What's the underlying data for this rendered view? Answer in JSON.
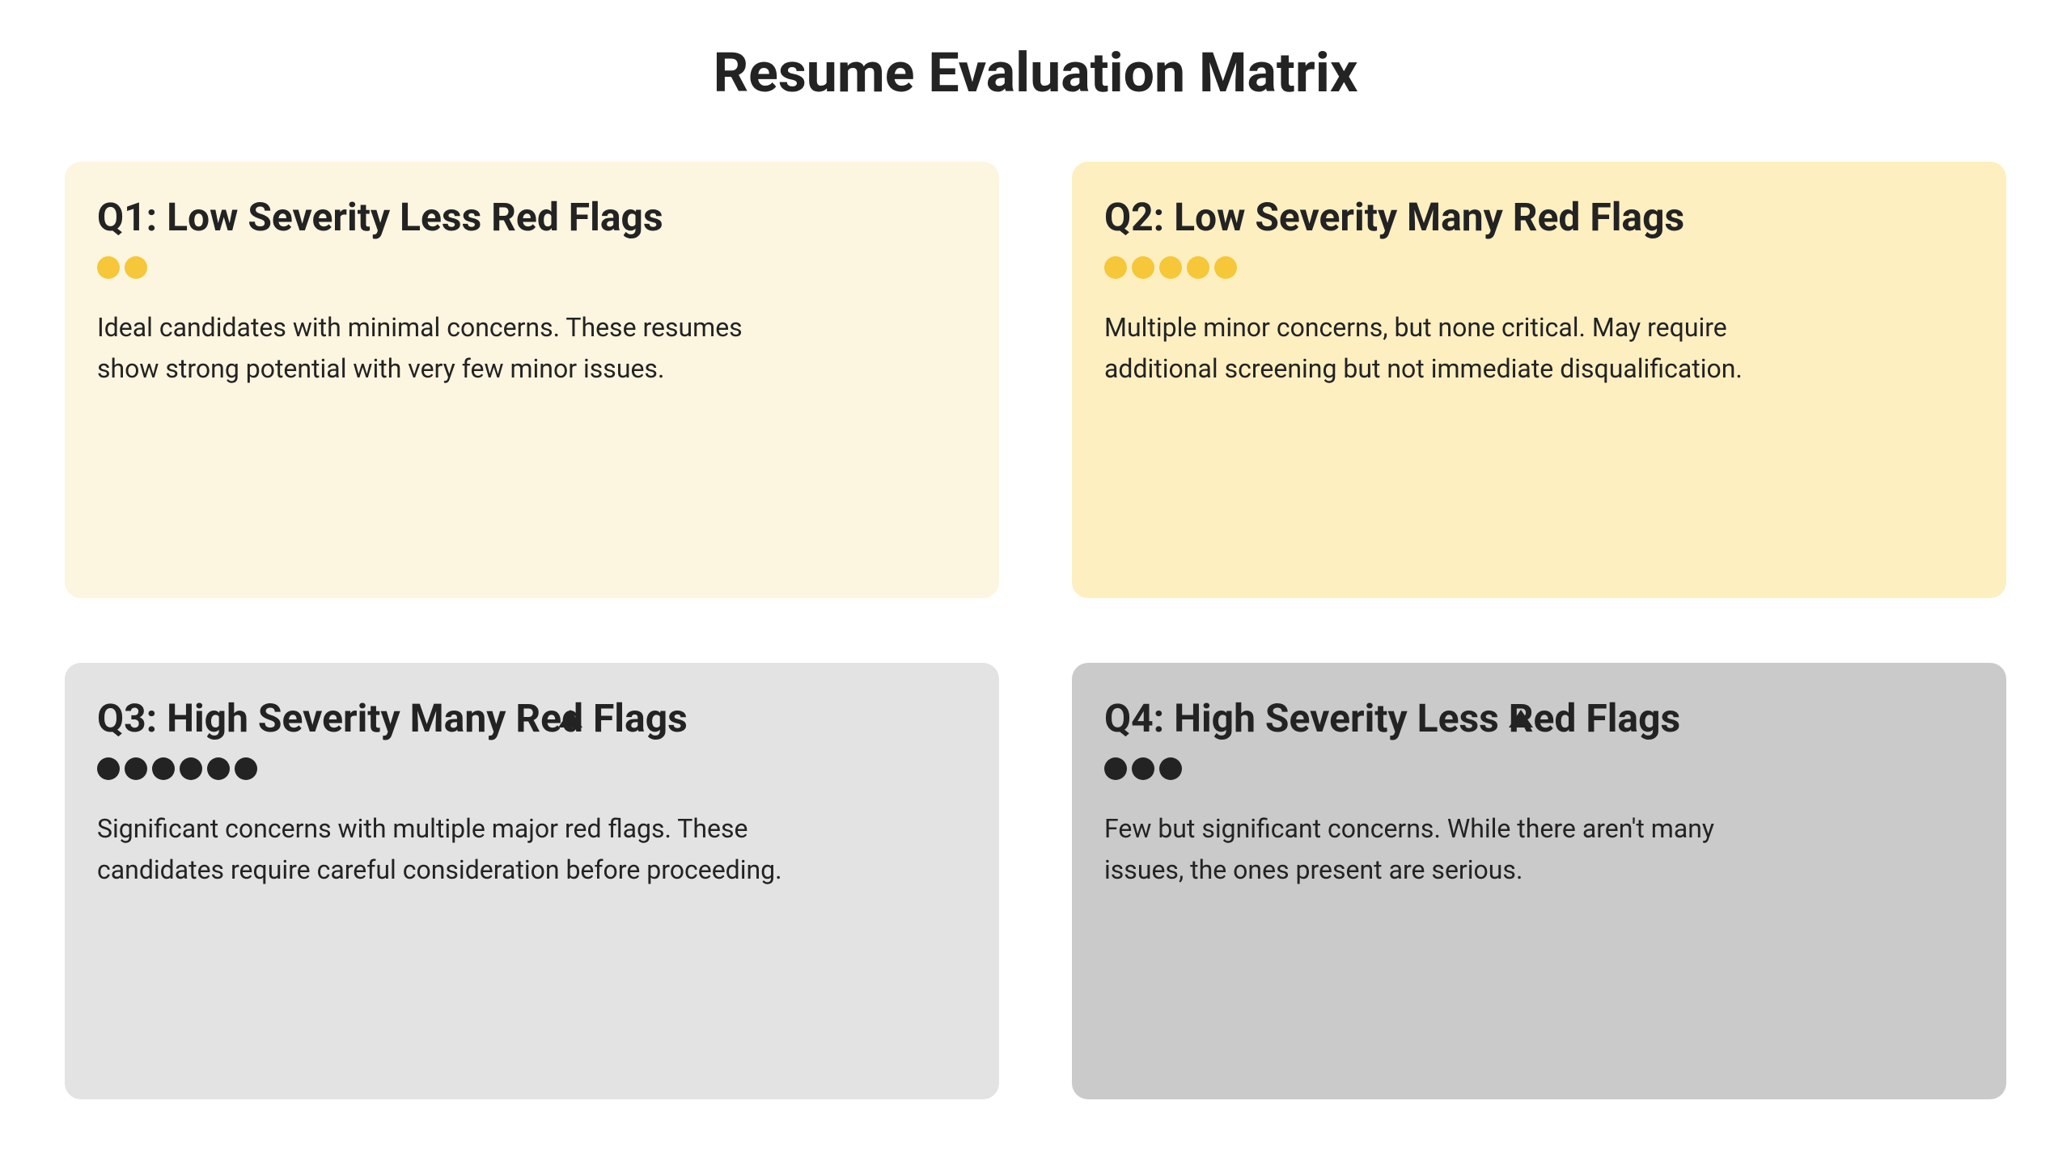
{
  "title": "Resume Evaluation Matrix",
  "quadrants": {
    "q1": {
      "heading": "Q1: Low Severity Less Red Flags",
      "dots": 2,
      "dotColor": "yellow",
      "body": "Ideal candidates with minimal concerns. These resumes show strong potential with very few minor issues."
    },
    "q2": {
      "heading": "Q2: Low Severity Many Red Flags",
      "dots": 5,
      "dotColor": "yellow",
      "body": "Multiple minor concerns, but none critical. May require additional screening but not immediate disqualification."
    },
    "q3": {
      "heading": "Q3: High Severity Many Red Flags",
      "dots": 6,
      "dotColor": "dark",
      "body": "Significant concerns with multiple major red flags. These candidates require careful consideration before proceeding."
    },
    "q4": {
      "heading": "Q4: High Severity Less Red Flags",
      "dots": 3,
      "dotColor": "dark",
      "body": "Few but significant concerns. While there aren't many issues, the ones present are serious."
    }
  }
}
